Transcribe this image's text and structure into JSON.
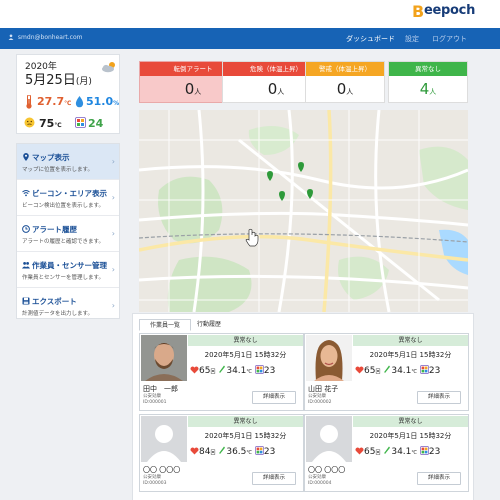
{
  "header": {
    "user_email": "smdn@bonheart.com",
    "logo_text": "eepoch",
    "nav": {
      "dashboard": "ダッシュボード",
      "settings": "設定",
      "logout": "ログアウト"
    }
  },
  "date_card": {
    "year": "2020年",
    "month_day": "5月25日",
    "weekday": "(月)",
    "temperature": "27.7",
    "temperature_unit": "℃",
    "humidity": "51.0",
    "humidity_unit": "%",
    "heat_index": "75",
    "heat_index_unit": "℃",
    "wbgt": "24"
  },
  "menu": {
    "items": [
      {
        "label": "マップ表示",
        "desc": "マップに位置を表示します。",
        "icon": "map-pin-icon"
      },
      {
        "label": "ビーコン・エリア表示",
        "desc": "ビーコン検出位置を表示します。",
        "icon": "wifi-icon"
      },
      {
        "label": "アラート履歴",
        "desc": "アラートの履歴と確認できます。",
        "icon": "clock-icon"
      },
      {
        "label": "作業員・センサー管理",
        "desc": "作業員とセンサーを管理します。",
        "icon": "users-icon"
      },
      {
        "label": "エクスポート",
        "desc": "計測値データを出力します。",
        "icon": "save-icon"
      }
    ]
  },
  "alerts": [
    {
      "label": "転倒アラート",
      "value": "0",
      "unit": "人",
      "color": "#e84a3a",
      "bg": "#f8c9c9"
    },
    {
      "label": "危険（体温上昇）",
      "value": "0",
      "unit": "人",
      "color": "#e84a3a",
      "bg": "#ffffff"
    },
    {
      "label": "警戒（体温上昇）",
      "value": "0",
      "unit": "人",
      "color": "#f5a623",
      "bg": "#ffffff"
    },
    {
      "label": "異常なし",
      "value": "4",
      "unit": "人",
      "color": "#3fb54a",
      "bg": "#ffffff"
    }
  ],
  "tabs": {
    "workers": "作業員一覧",
    "history": "行動履歴"
  },
  "workers": [
    {
      "status": "異常なし",
      "datetime": "2020年5月1日 15時32分",
      "heart": "65",
      "heart_unit": "回",
      "temp": "34.1",
      "temp_unit": "℃",
      "wbgt": "23",
      "name": "田中　一郎",
      "company": "公安効康",
      "id": "ID:000001",
      "detail": "詳細表示",
      "photo": "male"
    },
    {
      "status": "異常なし",
      "datetime": "2020年5月1日 15時32分",
      "heart": "65",
      "heart_unit": "回",
      "temp": "34.1",
      "temp_unit": "℃",
      "wbgt": "23",
      "name": "山田 花子",
      "company": "公安効康",
      "id": "ID:000002",
      "detail": "詳細表示",
      "photo": "female"
    },
    {
      "status": "異常なし",
      "datetime": "2020年5月1日 15時32分",
      "heart": "84",
      "heart_unit": "回",
      "temp": "36.5",
      "temp_unit": "℃",
      "wbgt": "23",
      "name": "〇〇 〇〇〇",
      "company": "公安効康",
      "id": "ID:000003",
      "detail": "詳細表示",
      "photo": "placeholder"
    },
    {
      "status": "異常なし",
      "datetime": "2020年5月1日 15時32分",
      "heart": "65",
      "heart_unit": "回",
      "temp": "34.1",
      "temp_unit": "℃",
      "wbgt": "23",
      "name": "〇〇 〇〇〇",
      "company": "公安効康",
      "id": "ID:000004",
      "detail": "詳細表示",
      "photo": "placeholder"
    }
  ]
}
